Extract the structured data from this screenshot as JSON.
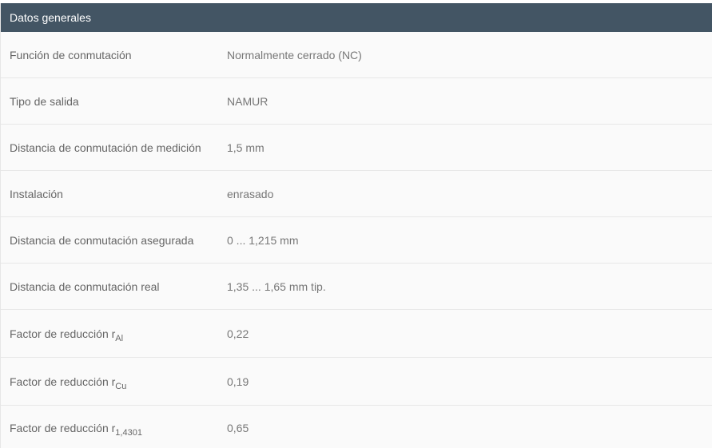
{
  "header": {
    "title": "Datos generales"
  },
  "rows": [
    {
      "label": "Función de conmutación",
      "value": "Normalmente cerrado (NC)"
    },
    {
      "label": "Tipo de salida",
      "value": "NAMUR"
    },
    {
      "label": "Distancia de conmutación de medición",
      "value": "1,5 mm"
    },
    {
      "label": "Instalación",
      "value": "enrasado"
    },
    {
      "label": "Distancia de conmutación asegurada",
      "value": "0 ... 1,215 mm"
    },
    {
      "label": "Distancia de conmutación real",
      "value": "1,35 ... 1,65 mm tip."
    },
    {
      "label": "Factor de reducción r",
      "sub": "Al",
      "value": "0,22"
    },
    {
      "label": "Factor de reducción r",
      "sub": "Cu",
      "value": "0,19"
    },
    {
      "label": "Factor de reducción r",
      "sub": "1,4301",
      "value": "0,65"
    }
  ]
}
